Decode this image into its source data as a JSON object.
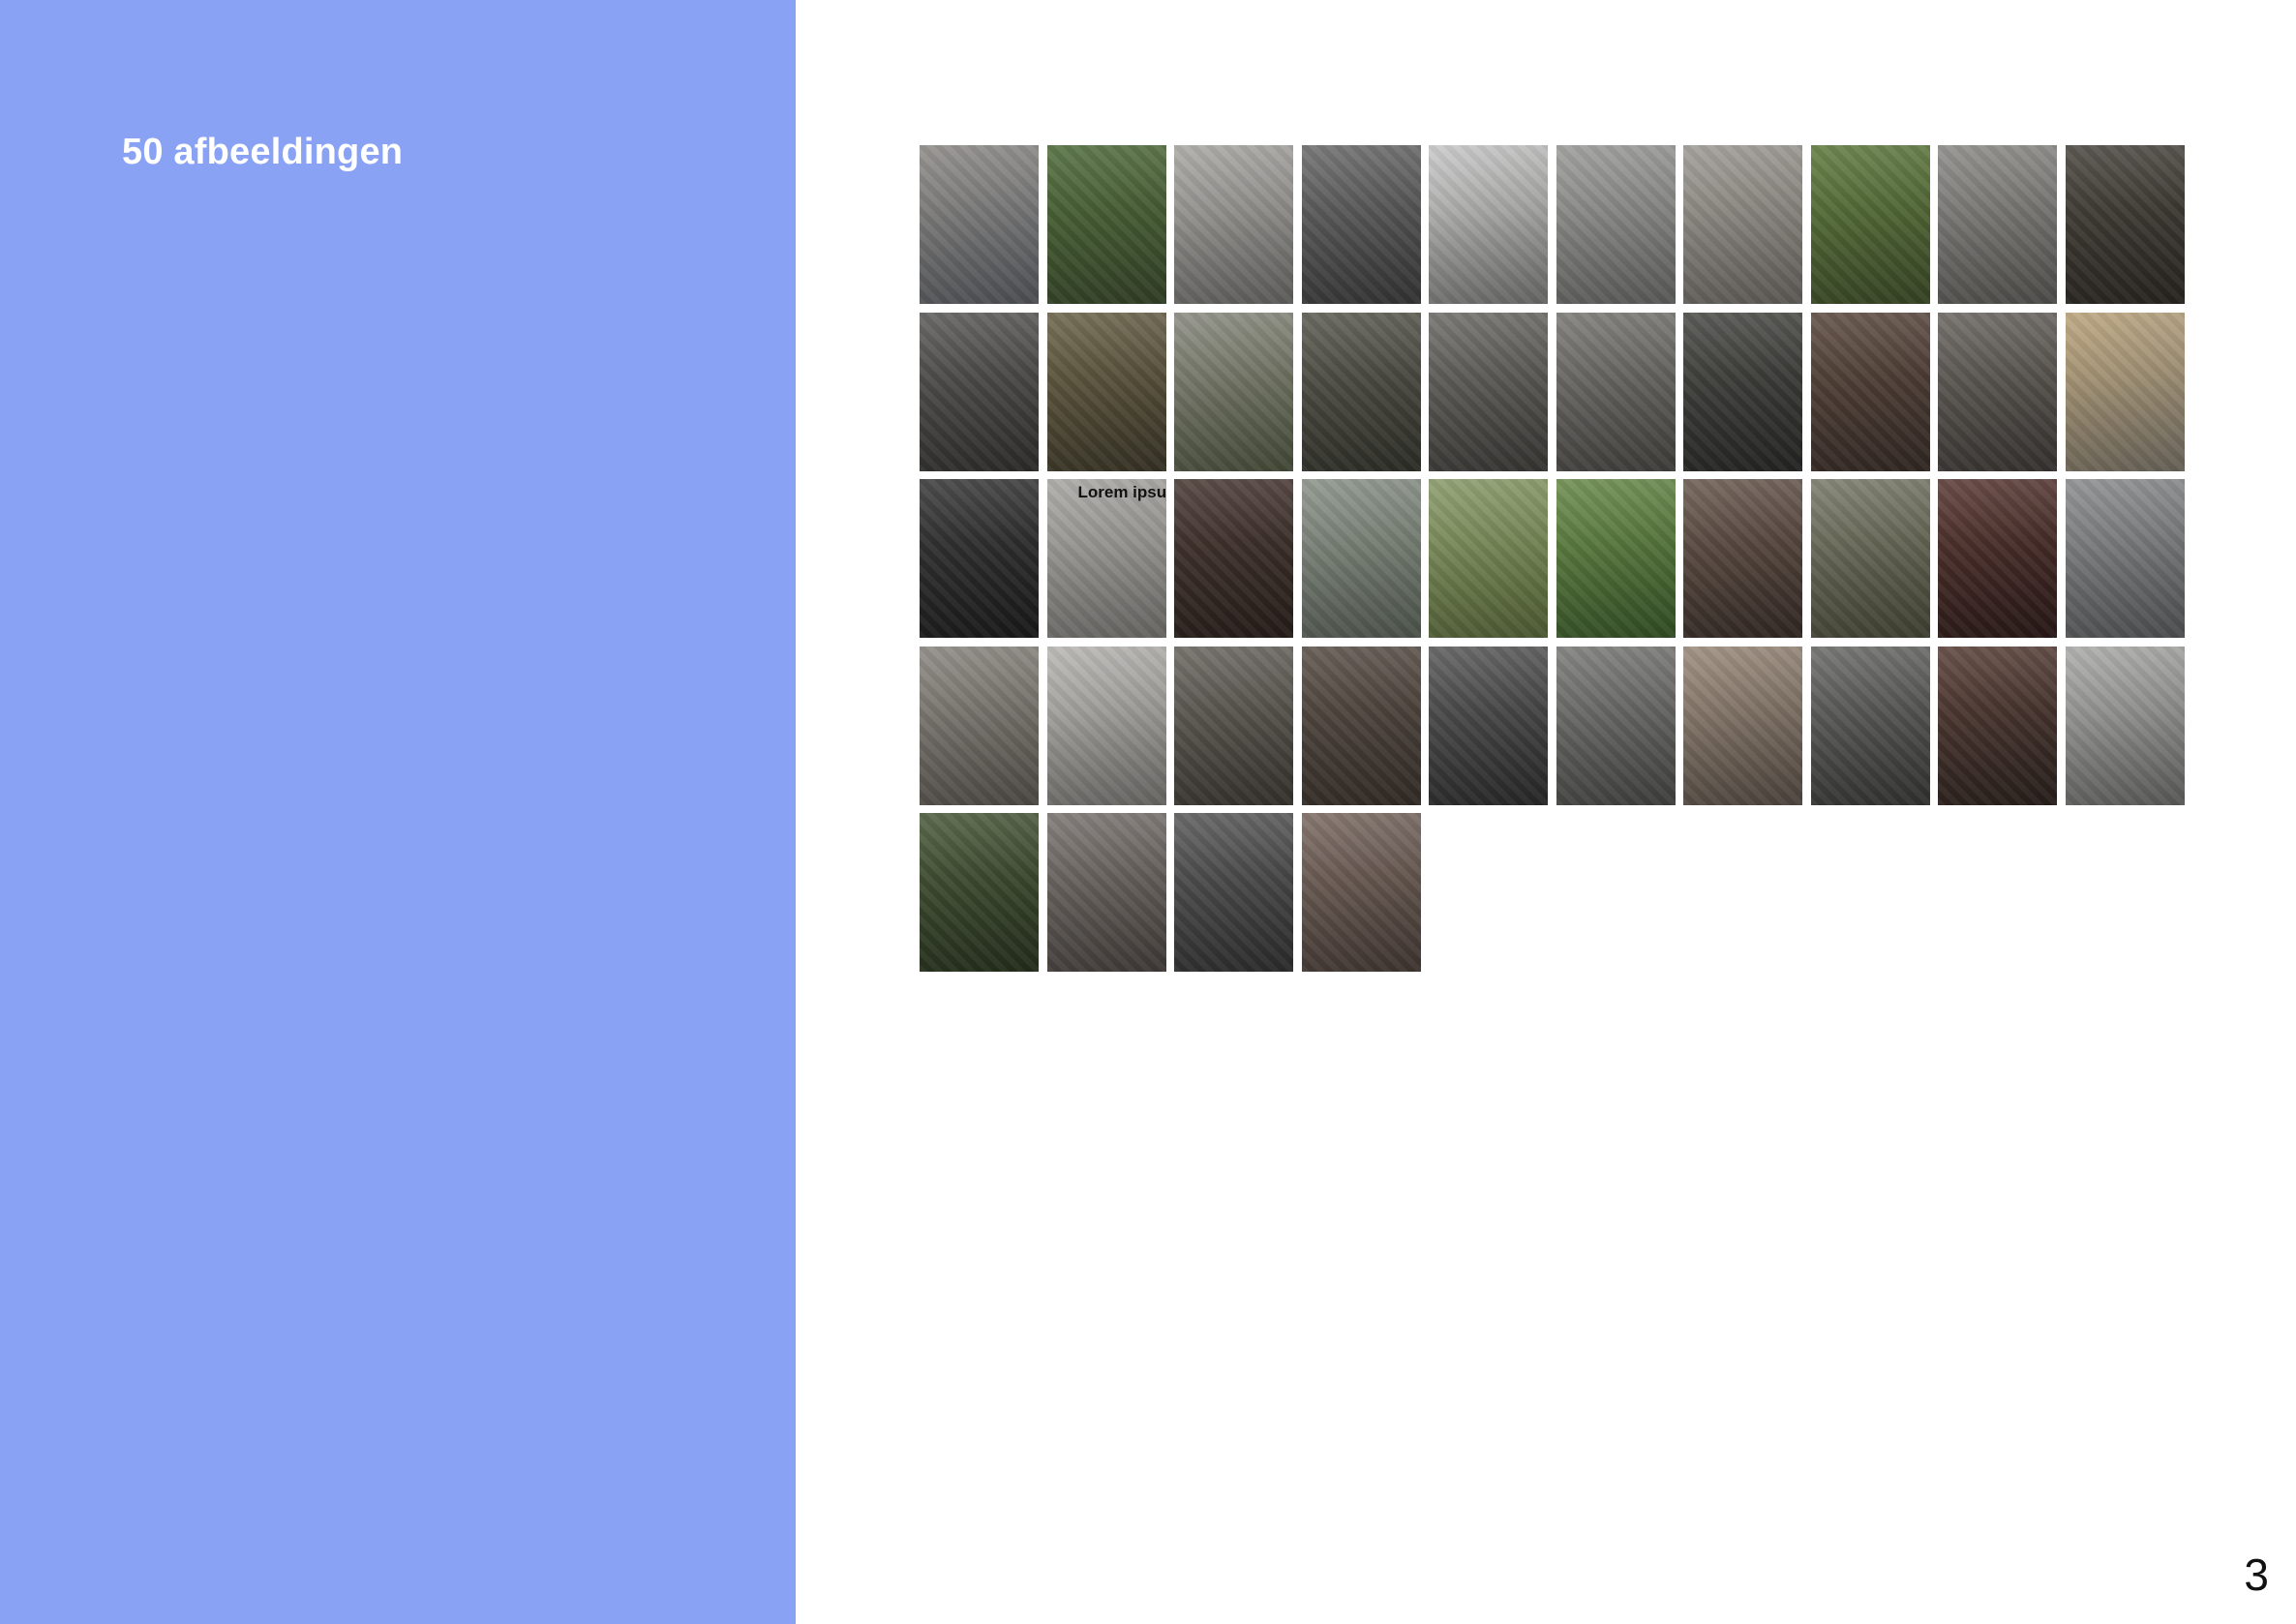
{
  "sidebar": {
    "title": "50 afbeeldingen",
    "background": "#8aa2f4"
  },
  "gallery": {
    "caption": "Lorem ipsum",
    "caption_cell": 21,
    "thumbnails": [
      {
        "colors": [
          "#8d8a86",
          "#5b5e63"
        ]
      },
      {
        "colors": [
          "#4f6b3a",
          "#3a4a2c"
        ]
      },
      {
        "colors": [
          "#a9a7a3",
          "#6e6d6a"
        ]
      },
      {
        "colors": [
          "#6b6b6b",
          "#3c3c3c"
        ]
      },
      {
        "colors": [
          "#c8c8c8",
          "#7a7a78"
        ]
      },
      {
        "colors": [
          "#9a9a98",
          "#6a6a68"
        ]
      },
      {
        "colors": [
          "#9d9a94",
          "#6d6a64"
        ]
      },
      {
        "colors": [
          "#5f7a3e",
          "#3f4f2a"
        ]
      },
      {
        "colors": [
          "#8c8a86",
          "#5c5a56"
        ]
      },
      {
        "colors": [
          "#4a4640",
          "#2e2a24"
        ]
      },
      {
        "colors": [
          "#5b5a58",
          "#343331"
        ]
      },
      {
        "colors": [
          "#6a6248",
          "#3f3a2a"
        ]
      },
      {
        "colors": [
          "#8a8a80",
          "#4f5640"
        ]
      },
      {
        "colors": [
          "#5a5a50",
          "#35352e"
        ]
      },
      {
        "colors": [
          "#6e6c68",
          "#403e3a"
        ]
      },
      {
        "colors": [
          "#7a7874",
          "#4a4844"
        ]
      },
      {
        "colors": [
          "#4a4a46",
          "#2a2a28"
        ]
      },
      {
        "colors": [
          "#5c4a40",
          "#3a2e28"
        ]
      },
      {
        "colors": [
          "#6a6560",
          "#3f3b37"
        ]
      },
      {
        "colors": [
          "#b9a27a",
          "#7a7468"
        ]
      },
      {
        "colors": [
          "#3a3a3a",
          "#1e1e1e"
        ]
      },
      {
        "colors": [
          "#a8a6a2",
          "#7a7874"
        ]
      },
      {
        "colors": [
          "#4a3a34",
          "#2c221e"
        ]
      },
      {
        "colors": [
          "#8a9288",
          "#5a6258"
        ]
      },
      {
        "colors": [
          "#8a9a6a",
          "#5a6a3a"
        ]
      },
      {
        "colors": [
          "#6a8a4a",
          "#3a5a2a"
        ]
      },
      {
        "colors": [
          "#6a5a50",
          "#3a2e28"
        ]
      },
      {
        "colors": [
          "#7a7a6a",
          "#4a4a3a"
        ]
      },
      {
        "colors": [
          "#5a3a34",
          "#2e1c1a"
        ]
      },
      {
        "colors": [
          "#8a8c8e",
          "#5a5c5e"
        ]
      },
      {
        "colors": [
          "#8a8680",
          "#5a5650"
        ]
      },
      {
        "colors": [
          "#b8b6b2",
          "#7a7874"
        ]
      },
      {
        "colors": [
          "#6a6660",
          "#3e3a34"
        ]
      },
      {
        "colors": [
          "#5a5048",
          "#3a322c"
        ]
      },
      {
        "colors": [
          "#5a5a5a",
          "#2e2e2e"
        ]
      },
      {
        "colors": [
          "#7a7a78",
          "#4a4a48"
        ]
      },
      {
        "colors": [
          "#9a8a7a",
          "#5a5048"
        ]
      },
      {
        "colors": [
          "#6a6a68",
          "#3a3a38"
        ]
      },
      {
        "colors": [
          "#5a4038",
          "#2e2420"
        ]
      },
      {
        "colors": [
          "#aaaaa8",
          "#6a6a68"
        ]
      },
      {
        "colors": [
          "#4a5a3a",
          "#2a3420"
        ]
      },
      {
        "colors": [
          "#7a7470",
          "#4a4440"
        ]
      },
      {
        "colors": [
          "#5a5a5a",
          "#333333"
        ]
      },
      {
        "colors": [
          "#7a6a62",
          "#4a3e38"
        ]
      }
    ]
  },
  "footer": {
    "page_number": "3"
  }
}
